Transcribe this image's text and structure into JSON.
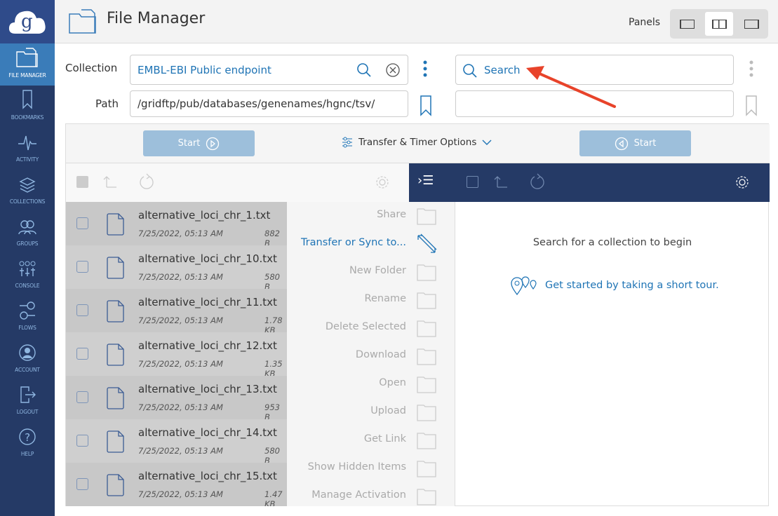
{
  "app": {
    "title": "File Manager"
  },
  "sidebar": {
    "items": [
      {
        "label": "FILE MANAGER",
        "icon": "folder-icon",
        "active": true
      },
      {
        "label": "BOOKMARKS",
        "icon": "bookmark-icon"
      },
      {
        "label": "ACTIVITY",
        "icon": "activity-icon"
      },
      {
        "label": "COLLECTIONS",
        "icon": "layers-icon"
      },
      {
        "label": "GROUPS",
        "icon": "groups-icon"
      },
      {
        "label": "CONSOLE",
        "icon": "sliders-icon"
      },
      {
        "label": "FLOWS",
        "icon": "flows-icon"
      },
      {
        "label": "ACCOUNT",
        "icon": "account-icon"
      },
      {
        "label": "LOGOUT",
        "icon": "logout-icon"
      },
      {
        "label": "HELP",
        "icon": "help-icon"
      }
    ]
  },
  "header": {
    "panels_label": "Panels",
    "selected_layout": "two-panel"
  },
  "left": {
    "collection_label": "Collection",
    "collection_value": "EMBL-EBI Public endpoint",
    "path_label": "Path",
    "path_value": "/gridftp/pub/databases/genenames/hgnc/tsv/"
  },
  "right": {
    "search_placeholder": "Search",
    "path_value": "",
    "empty_message": "Search for a collection to begin",
    "tour_link": "Get started by taking a short tour."
  },
  "toolbar": {
    "start_left": "Start",
    "start_right": "Start",
    "options": "Transfer & Timer Options"
  },
  "files": [
    {
      "name": "alternative_loci_chr_1.txt",
      "date": "7/25/2022, 05:13 AM",
      "size": "882 B"
    },
    {
      "name": "alternative_loci_chr_10.txt",
      "date": "7/25/2022, 05:13 AM",
      "size": "580 B"
    },
    {
      "name": "alternative_loci_chr_11.txt",
      "date": "7/25/2022, 05:13 AM",
      "size": "1.78 KB"
    },
    {
      "name": "alternative_loci_chr_12.txt",
      "date": "7/25/2022, 05:13 AM",
      "size": "1.35 KB"
    },
    {
      "name": "alternative_loci_chr_13.txt",
      "date": "7/25/2022, 05:13 AM",
      "size": "953 B"
    },
    {
      "name": "alternative_loci_chr_14.txt",
      "date": "7/25/2022, 05:13 AM",
      "size": "580 B"
    },
    {
      "name": "alternative_loci_chr_15.txt",
      "date": "7/25/2022, 05:13 AM",
      "size": "1.47 KB"
    }
  ],
  "menu": [
    {
      "label": "Share",
      "enabled": false
    },
    {
      "label": "Transfer or Sync to...",
      "enabled": true
    },
    {
      "label": "New Folder",
      "enabled": false
    },
    {
      "label": "Rename",
      "enabled": false
    },
    {
      "label": "Delete Selected",
      "enabled": false
    },
    {
      "label": "Download",
      "enabled": false
    },
    {
      "label": "Open",
      "enabled": false
    },
    {
      "label": "Upload",
      "enabled": false
    },
    {
      "label": "Get Link",
      "enabled": false
    },
    {
      "label": "Show Hidden Items",
      "enabled": false
    },
    {
      "label": "Manage Activation",
      "enabled": false
    }
  ],
  "colors": {
    "sidebar": "#253a66",
    "accent": "#1f74b5",
    "annotation_arrow": "#e8432a"
  }
}
